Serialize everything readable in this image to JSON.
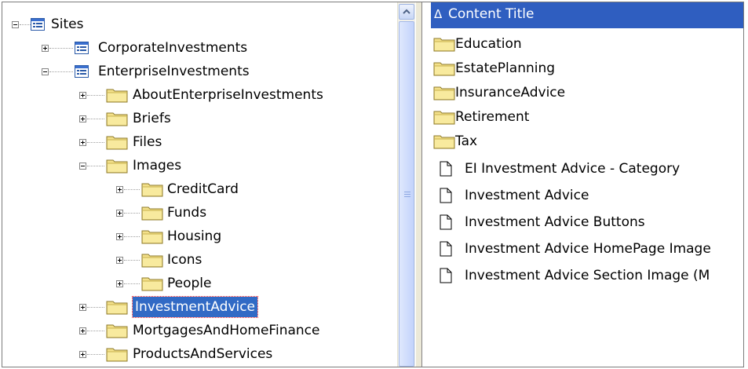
{
  "tree": {
    "root": {
      "label": "Sites",
      "expanded": true
    },
    "items": [
      {
        "label": "CorporateInvestments",
        "icon": "site-icon",
        "expanded": false
      },
      {
        "label": "EnterpriseInvestments",
        "icon": "site-icon",
        "expanded": true
      },
      {
        "label": "AboutEnterpriseInvestments",
        "icon": "folder-icon",
        "expanded": false
      },
      {
        "label": "Briefs",
        "icon": "folder-icon",
        "expanded": false
      },
      {
        "label": "Files",
        "icon": "folder-icon",
        "expanded": false
      },
      {
        "label": "Images",
        "icon": "folder-icon",
        "expanded": true
      },
      {
        "label": "CreditCard",
        "icon": "folder-icon",
        "expanded": false
      },
      {
        "label": "Funds",
        "icon": "folder-icon",
        "expanded": false
      },
      {
        "label": "Housing",
        "icon": "folder-icon",
        "expanded": false
      },
      {
        "label": "Icons",
        "icon": "folder-icon",
        "expanded": false
      },
      {
        "label": "People",
        "icon": "folder-icon",
        "expanded": false
      },
      {
        "label": "InvestmentAdvice",
        "icon": "folder-icon",
        "expanded": false,
        "selected": true
      },
      {
        "label": "MortgagesAndHomeFinance",
        "icon": "folder-icon",
        "expanded": false
      },
      {
        "label": "ProductsAndServices",
        "icon": "folder-icon",
        "expanded": false
      }
    ]
  },
  "list": {
    "header": {
      "sort_indicator": "Δ",
      "label": "Content Title"
    },
    "folders": [
      {
        "label": "Education"
      },
      {
        "label": "EstatePlanning"
      },
      {
        "label": "InsuranceAdvice"
      },
      {
        "label": "Retirement"
      },
      {
        "label": "Tax"
      }
    ],
    "documents": [
      {
        "label": "EI Investment Advice - Category"
      },
      {
        "label": "Investment Advice"
      },
      {
        "label": "Investment Advice Buttons"
      },
      {
        "label": "Investment Advice HomePage Image"
      },
      {
        "label": "Investment Advice Section Image (M"
      }
    ]
  },
  "colors": {
    "selection": "#316ac5",
    "header": "#2f5ec0",
    "folder": "#f3e08a",
    "splitter": "#ece9d8"
  }
}
